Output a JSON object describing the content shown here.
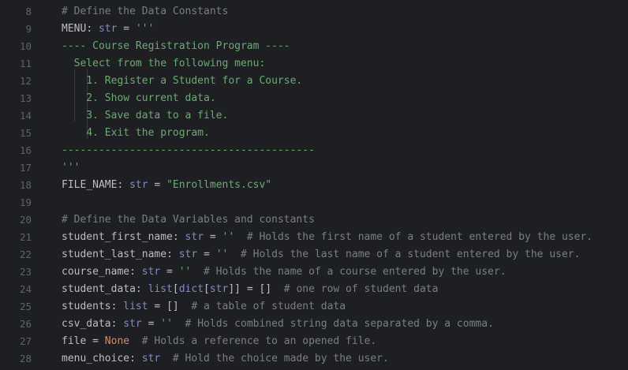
{
  "editor": {
    "line_numbers": [
      "8",
      "9",
      "10",
      "11",
      "12",
      "13",
      "14",
      "15",
      "16",
      "17",
      "18",
      "19",
      "20",
      "21",
      "22",
      "23",
      "24",
      "25",
      "26",
      "27",
      "28"
    ],
    "lines": [
      [
        {
          "t": "# Define the Data Constants",
          "c": "cmt"
        }
      ],
      [
        {
          "t": "MENU",
          "c": "idt"
        },
        {
          "t": ": ",
          "c": "op"
        },
        {
          "t": "str",
          "c": "typ"
        },
        {
          "t": " = ",
          "c": "op"
        },
        {
          "t": "'''",
          "c": "str"
        }
      ],
      [
        {
          "t": "---- Course Registration Program ----",
          "c": "str"
        }
      ],
      [
        {
          "t": "  Select from the following menu:",
          "c": "str"
        }
      ],
      [
        {
          "t": "    1. Register a Student for a Course.",
          "c": "str"
        }
      ],
      [
        {
          "t": "    2. Show current data.",
          "c": "str"
        }
      ],
      [
        {
          "t": "    3. Save data to a file.",
          "c": "str"
        }
      ],
      [
        {
          "t": "    4. Exit the program.",
          "c": "str"
        }
      ],
      [
        {
          "t": "-----------------------------------------",
          "c": "str"
        }
      ],
      [
        {
          "t": "'''",
          "c": "str"
        }
      ],
      [
        {
          "t": "FILE_NAME",
          "c": "idt"
        },
        {
          "t": ": ",
          "c": "op"
        },
        {
          "t": "str",
          "c": "typ"
        },
        {
          "t": " = ",
          "c": "op"
        },
        {
          "t": "\"Enrollments.csv\"",
          "c": "str"
        }
      ],
      [],
      [
        {
          "t": "# Define the Data Variables and constants",
          "c": "cmt"
        }
      ],
      [
        {
          "t": "student_first_name",
          "c": "idt"
        },
        {
          "t": ": ",
          "c": "op"
        },
        {
          "t": "str",
          "c": "typ"
        },
        {
          "t": " = ",
          "c": "op"
        },
        {
          "t": "''",
          "c": "str"
        },
        {
          "t": "  # Holds the first name of a student entered by the user.",
          "c": "cmt"
        }
      ],
      [
        {
          "t": "student_last_name",
          "c": "idt"
        },
        {
          "t": ": ",
          "c": "op"
        },
        {
          "t": "str",
          "c": "typ"
        },
        {
          "t": " = ",
          "c": "op"
        },
        {
          "t": "''",
          "c": "str"
        },
        {
          "t": "  # Holds the last name of a student entered by the user.",
          "c": "cmt"
        }
      ],
      [
        {
          "t": "course_name",
          "c": "idt"
        },
        {
          "t": ": ",
          "c": "op"
        },
        {
          "t": "str",
          "c": "typ"
        },
        {
          "t": " = ",
          "c": "op"
        },
        {
          "t": "''",
          "c": "str"
        },
        {
          "t": "  # Holds the name of a course entered by the user.",
          "c": "cmt"
        }
      ],
      [
        {
          "t": "student_data",
          "c": "idt"
        },
        {
          "t": ": ",
          "c": "op"
        },
        {
          "t": "list",
          "c": "typ"
        },
        {
          "t": "[",
          "c": "op"
        },
        {
          "t": "dict",
          "c": "typ"
        },
        {
          "t": "[",
          "c": "op"
        },
        {
          "t": "str",
          "c": "typ"
        },
        {
          "t": "]] = []",
          "c": "op"
        },
        {
          "t": "  # one row of student data",
          "c": "cmt"
        }
      ],
      [
        {
          "t": "students",
          "c": "idt"
        },
        {
          "t": ": ",
          "c": "op"
        },
        {
          "t": "list",
          "c": "typ"
        },
        {
          "t": " = []",
          "c": "op"
        },
        {
          "t": "  # a table of student data",
          "c": "cmt"
        }
      ],
      [
        {
          "t": "csv_data",
          "c": "idt"
        },
        {
          "t": ": ",
          "c": "op"
        },
        {
          "t": "str",
          "c": "typ"
        },
        {
          "t": " = ",
          "c": "op"
        },
        {
          "t": "''",
          "c": "str"
        },
        {
          "t": "  # Holds combined string data separated by a comma.",
          "c": "cmt"
        }
      ],
      [
        {
          "t": "file",
          "c": "idt"
        },
        {
          "t": " = ",
          "c": "op"
        },
        {
          "t": "None",
          "c": "kw"
        },
        {
          "t": "  # Holds a reference to an opened file.",
          "c": "cmt"
        }
      ],
      [
        {
          "t": "menu_choice",
          "c": "idt"
        },
        {
          "t": ": ",
          "c": "op"
        },
        {
          "t": "str",
          "c": "typ"
        },
        {
          "t": "  # Hold the choice made by the user.",
          "c": "cmt"
        }
      ]
    ]
  },
  "colors": {
    "background": "#1e1f22",
    "line_number": "#5f6266",
    "comment": "#7a7e85",
    "string": "#6aab73",
    "builtin_type": "#8888c6",
    "keyword": "#cf8e6d",
    "identifier": "#bcbec4",
    "indent_guide": "#393b40"
  }
}
